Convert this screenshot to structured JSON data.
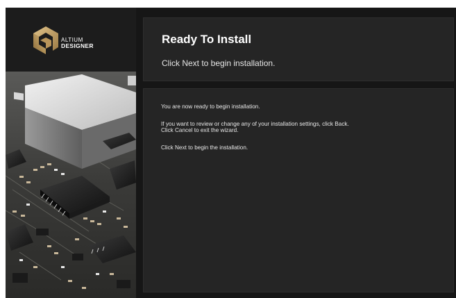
{
  "brand": {
    "line1": "ALTIUM",
    "line2": "DESIGNER",
    "logo_icon": "altium-logo-icon",
    "accent": "#c9a86a"
  },
  "header": {
    "title": "Ready To Install",
    "subtitle": "Click Next to begin installation."
  },
  "content": {
    "line1": "You are now ready to begin installation.",
    "line2": "If you want to review or change any of your installation settings, click Back.",
    "line3": "Click Cancel to exit the wizard.",
    "line4": "Click Next to begin the installation."
  },
  "colors": {
    "window_bg": "#161616",
    "panel_bg": "#252525",
    "text": "#e8e8e8"
  }
}
